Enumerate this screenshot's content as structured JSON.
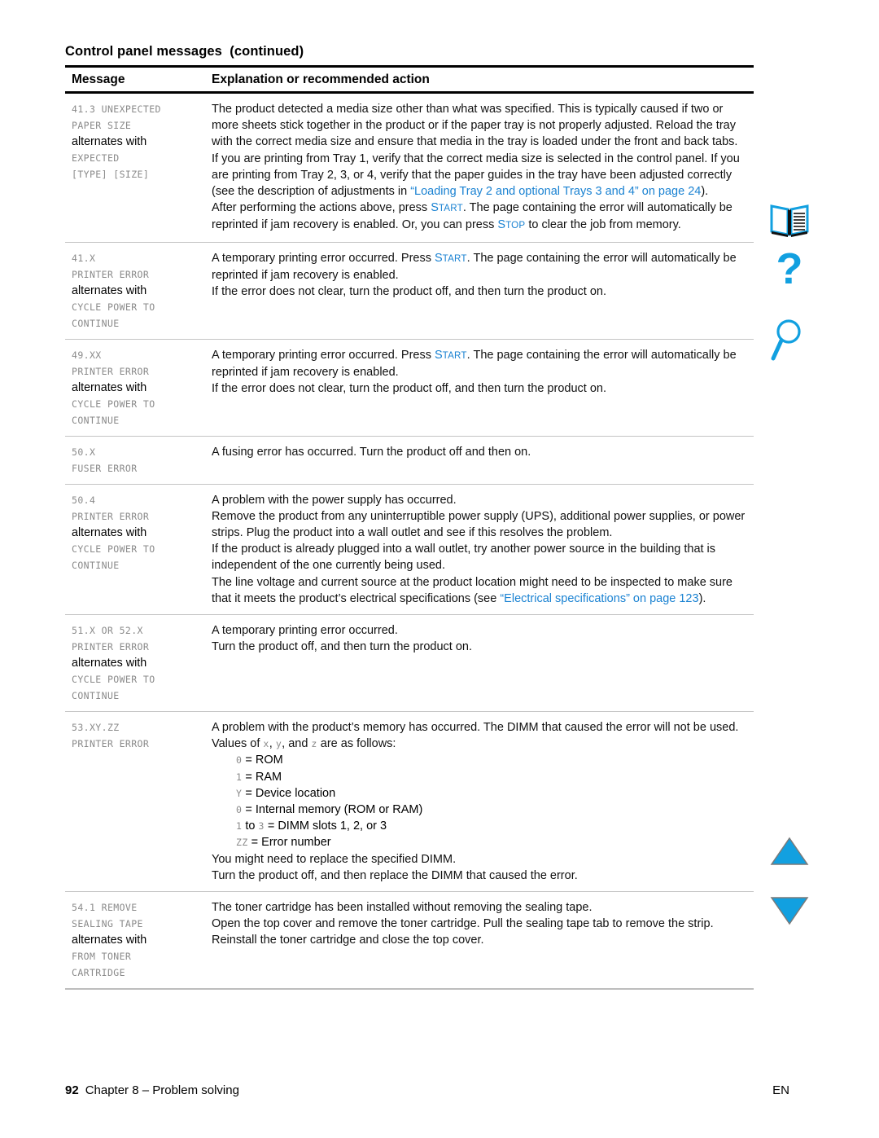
{
  "page": {
    "title": "Control panel messages  (continued)",
    "link_color": "#1a82d2",
    "mono_color": "#8a8a8a"
  },
  "table": {
    "headers": {
      "message": "Message",
      "explanation": "Explanation or recommended action"
    },
    "alternates_label": "alternates with",
    "rows": [
      {
        "code_lines_before": [
          "41.3 UNEXPECTED",
          "PAPER SIZE"
        ],
        "code_lines_after": [
          "EXPECTED",
          "[TYPE] [SIZE]"
        ],
        "paragraphs": [
          {
            "parts": [
              {
                "t": "The product detected a media size other than what was specified. This is typically caused if two or more sheets stick together in the product or if the paper tray is not properly adjusted. Reload the tray with the correct media size and ensure that media in the tray is loaded under the front and back tabs.",
                "k": "plain"
              }
            ]
          },
          {
            "parts": [
              {
                "t": "If you are printing from Tray 1, verify that the correct media size is selected in the control panel. If you are printing from Tray 2, 3, or 4, verify that the paper guides in the tray have been adjusted correctly (see the description of adjustments in ",
                "k": "plain"
              },
              {
                "t": "“Loading Tray 2 and optional Trays 3 and 4” on page 24",
                "k": "link"
              },
              {
                "t": ").",
                "k": "plain"
              }
            ]
          },
          {
            "parts": [
              {
                "t": "After performing the actions above, press ",
                "k": "plain"
              },
              {
                "t": "START",
                "k": "smallcaps"
              },
              {
                "t": ". The page containing the error will automatically be reprinted if jam recovery is enabled. Or, you can press ",
                "k": "plain"
              },
              {
                "t": "STOP",
                "k": "smallcaps"
              },
              {
                "t": " to clear the job from memory.",
                "k": "plain"
              }
            ]
          }
        ]
      },
      {
        "code_lines_before": [
          "41.X",
          "PRINTER ERROR"
        ],
        "code_lines_after": [
          "CYCLE POWER TO",
          "CONTINUE"
        ],
        "paragraphs": [
          {
            "parts": [
              {
                "t": "A temporary printing error occurred. Press ",
                "k": "plain"
              },
              {
                "t": "START",
                "k": "smallcaps"
              },
              {
                "t": ". The page containing the error will automatically be reprinted if jam recovery is enabled.",
                "k": "plain"
              }
            ]
          },
          {
            "parts": [
              {
                "t": "If the error does not clear, turn the product off, and then turn the product on.",
                "k": "plain"
              }
            ]
          }
        ]
      },
      {
        "code_lines_before": [
          "49.XX",
          "PRINTER ERROR"
        ],
        "code_lines_after": [
          "CYCLE POWER TO",
          "CONTINUE"
        ],
        "paragraphs": [
          {
            "parts": [
              {
                "t": "A temporary printing error occurred. Press ",
                "k": "plain"
              },
              {
                "t": "START",
                "k": "smallcaps"
              },
              {
                "t": ". The page containing the error will automatically be reprinted if jam recovery is enabled.",
                "k": "plain"
              }
            ]
          },
          {
            "parts": [
              {
                "t": "If the error does not clear, turn the product off, and then turn the product on.",
                "k": "plain"
              }
            ]
          }
        ]
      },
      {
        "code_lines_before": [
          "50.X",
          "FUSER ERROR"
        ],
        "code_lines_after": [],
        "paragraphs": [
          {
            "parts": [
              {
                "t": "A fusing error has occurred. Turn the product off and then on.",
                "k": "plain"
              }
            ]
          }
        ]
      },
      {
        "code_lines_before": [
          "50.4",
          "PRINTER ERROR"
        ],
        "code_lines_after": [
          "CYCLE POWER TO",
          "CONTINUE"
        ],
        "paragraphs": [
          {
            "parts": [
              {
                "t": "A problem with the power supply has occurred.",
                "k": "plain"
              }
            ]
          },
          {
            "parts": [
              {
                "t": "Remove the product from any uninterruptible power supply (UPS), additional power supplies, or power strips. Plug the product into a wall outlet and see if this resolves the problem.",
                "k": "plain"
              }
            ]
          },
          {
            "parts": [
              {
                "t": "If the product is already plugged into a wall outlet, try another power source in the building that is independent of the one currently being used.",
                "k": "plain"
              }
            ]
          },
          {
            "parts": [
              {
                "t": "The line voltage and current source at the product location might need to be inspected to make sure that it meets the product’s electrical specifications (see ",
                "k": "plain"
              },
              {
                "t": "“Electrical specifications” on page 123",
                "k": "link"
              },
              {
                "t": ").",
                "k": "plain"
              }
            ]
          }
        ]
      },
      {
        "code_lines_before": [
          "51.X OR 52.X",
          "PRINTER ERROR"
        ],
        "code_lines_after": [
          "CYCLE POWER TO",
          "CONTINUE"
        ],
        "paragraphs": [
          {
            "parts": [
              {
                "t": "A temporary printing error occurred.",
                "k": "plain"
              }
            ]
          },
          {
            "parts": [
              {
                "t": "Turn the product off, and then turn the product on.",
                "k": "plain"
              }
            ]
          }
        ]
      },
      {
        "code_lines_before": [
          "53.XY.ZZ",
          "PRINTER ERROR"
        ],
        "code_lines_after": [],
        "paragraphs": [
          {
            "parts": [
              {
                "t": "A problem with the product’s memory has occurred. The DIMM that caused the error will not be used. Values of ",
                "k": "plain"
              },
              {
                "t": "x",
                "k": "code"
              },
              {
                "t": ", ",
                "k": "plain"
              },
              {
                "t": "y",
                "k": "code"
              },
              {
                "t": ", and ",
                "k": "plain"
              },
              {
                "t": "z",
                "k": "code"
              },
              {
                "t": " are as follows:",
                "k": "plain"
              }
            ]
          }
        ],
        "value_list": [
          {
            "code": "0",
            "text": " = ROM"
          },
          {
            "code": "1",
            "text": " = RAM"
          },
          {
            "code": "Y",
            "text": "  = Device location"
          },
          {
            "code": "0",
            "text": " = Internal memory (ROM or RAM)"
          },
          {
            "code": "1",
            "text": " to ",
            "code2": "3",
            "text2": " = DIMM slots 1, 2, or 3"
          },
          {
            "code": "ZZ",
            "text": " = Error number"
          }
        ],
        "paragraphs_after": [
          {
            "parts": [
              {
                "t": "You might need to replace the specified DIMM.",
                "k": "plain"
              }
            ]
          },
          {
            "parts": [
              {
                "t": "Turn the product off, and then replace the DIMM that caused the error.",
                "k": "plain"
              }
            ]
          }
        ]
      },
      {
        "code_lines_before": [
          "54.1 REMOVE",
          "SEALING TAPE"
        ],
        "code_lines_after": [
          "FROM TONER",
          "CARTRIDGE"
        ],
        "paragraphs": [
          {
            "parts": [
              {
                "t": "The toner cartridge has been installed without removing the sealing tape.",
                "k": "plain"
              }
            ]
          },
          {
            "parts": [
              {
                "t": "Open the top cover and remove the toner cartridge. Pull the sealing tape tab to remove the strip.",
                "k": "plain"
              }
            ]
          },
          {
            "parts": [
              {
                "t": "Reinstall the toner cartridge and close the top cover.",
                "k": "plain"
              }
            ]
          }
        ]
      }
    ]
  },
  "nav": {
    "book": "contents-book-icon",
    "help": "help-question-icon",
    "find": "search-magnifier-icon",
    "prev": "previous-page-triangle-icon",
    "next": "next-page-triangle-icon",
    "accent": "#12A0E0"
  },
  "footer": {
    "page_number": "92",
    "chapter": "Chapter 8 – Problem solving",
    "language": "EN"
  }
}
